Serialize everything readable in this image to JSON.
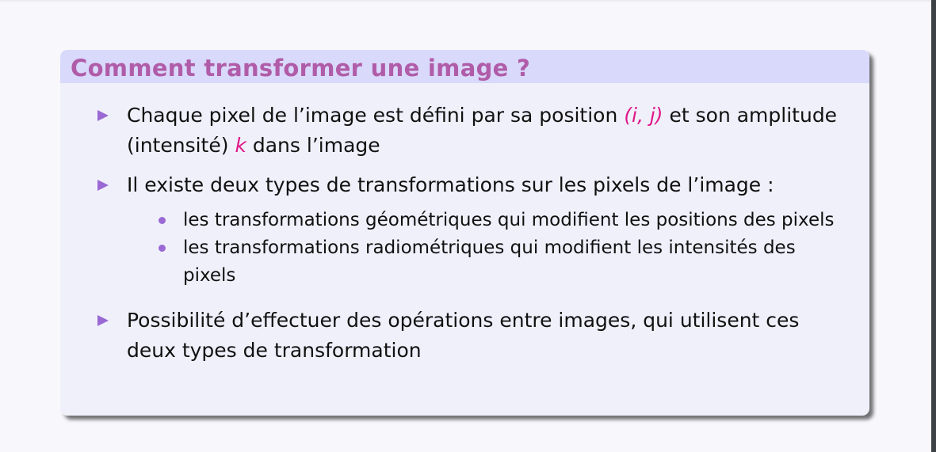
{
  "slide": {
    "title": "Comment transformer une image ?",
    "items": [
      {
        "before": "Chaque pixel de l’image est défini par sa position ",
        "math1": "(i, j)",
        "middle": " et son amplitude (intensité) ",
        "math2": "k",
        "after": " dans l’image"
      },
      {
        "text": "Il existe deux types de transformations sur les pixels de l’image :",
        "subitems": [
          "les transformations géométriques qui modifient les positions des pixels",
          "les transformations radiométriques qui modifient les intensités des pixels"
        ]
      },
      {
        "text": "Possibilité d’effectuer des opérations entre images, qui utilisent ces deux types de transformation"
      }
    ]
  },
  "colors": {
    "title": "#b05ca8",
    "header_bg": "#d9d9fb",
    "bullet": "#9a69d4",
    "math": "#e0198a"
  }
}
